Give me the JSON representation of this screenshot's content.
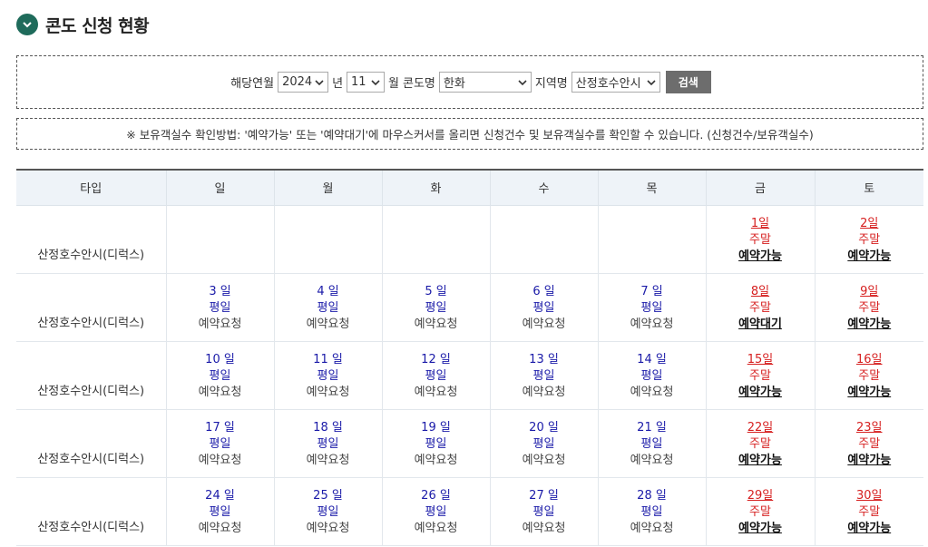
{
  "page_title": "콘도 신청 현황",
  "search": {
    "year_label": "해당연월",
    "year_value": "2024",
    "year_unit": "년",
    "month_value": "11",
    "month_unit": "월",
    "condo_label": "콘도명",
    "condo_value": "한화",
    "region_label": "지역명",
    "region_value": "산정호수안시",
    "search_button": "검색"
  },
  "notice": "※ 보유객실수 확인방법: '예약가능' 또는 '예약대기'에 마우스커서를 올리면 신청건수 및 보유객실수를 확인할 수 있습니다. (신청건수/보유객실수)",
  "columns": [
    "타입",
    "일",
    "월",
    "화",
    "수",
    "목",
    "금",
    "토"
  ],
  "rows": [
    {
      "type": "산정호수안시(디럭스)",
      "cells": [
        null,
        null,
        null,
        null,
        null,
        {
          "day": "1일",
          "kind": "주말",
          "status": "예약가능",
          "weekend": true
        },
        {
          "day": "2일",
          "kind": "주말",
          "status": "예약가능",
          "weekend": true
        }
      ]
    },
    {
      "type": "산정호수안시(디럭스)",
      "cells": [
        {
          "day": "3 일",
          "kind": "평일",
          "status": "예약요청",
          "weekend": false
        },
        {
          "day": "4 일",
          "kind": "평일",
          "status": "예약요청",
          "weekend": false
        },
        {
          "day": "5 일",
          "kind": "평일",
          "status": "예약요청",
          "weekend": false
        },
        {
          "day": "6 일",
          "kind": "평일",
          "status": "예약요청",
          "weekend": false
        },
        {
          "day": "7 일",
          "kind": "평일",
          "status": "예약요청",
          "weekend": false
        },
        {
          "day": "8일",
          "kind": "주말",
          "status": "예약대기",
          "weekend": true
        },
        {
          "day": "9일",
          "kind": "주말",
          "status": "예약가능",
          "weekend": true
        }
      ]
    },
    {
      "type": "산정호수안시(디럭스)",
      "cells": [
        {
          "day": "10 일",
          "kind": "평일",
          "status": "예약요청",
          "weekend": false
        },
        {
          "day": "11 일",
          "kind": "평일",
          "status": "예약요청",
          "weekend": false
        },
        {
          "day": "12 일",
          "kind": "평일",
          "status": "예약요청",
          "weekend": false
        },
        {
          "day": "13 일",
          "kind": "평일",
          "status": "예약요청",
          "weekend": false
        },
        {
          "day": "14 일",
          "kind": "평일",
          "status": "예약요청",
          "weekend": false
        },
        {
          "day": "15일",
          "kind": "주말",
          "status": "예약가능",
          "weekend": true
        },
        {
          "day": "16일",
          "kind": "주말",
          "status": "예약가능",
          "weekend": true
        }
      ]
    },
    {
      "type": "산정호수안시(디럭스)",
      "cells": [
        {
          "day": "17 일",
          "kind": "평일",
          "status": "예약요청",
          "weekend": false
        },
        {
          "day": "18 일",
          "kind": "평일",
          "status": "예약요청",
          "weekend": false
        },
        {
          "day": "19 일",
          "kind": "평일",
          "status": "예약요청",
          "weekend": false
        },
        {
          "day": "20 일",
          "kind": "평일",
          "status": "예약요청",
          "weekend": false
        },
        {
          "day": "21 일",
          "kind": "평일",
          "status": "예약요청",
          "weekend": false
        },
        {
          "day": "22일",
          "kind": "주말",
          "status": "예약가능",
          "weekend": true
        },
        {
          "day": "23일",
          "kind": "주말",
          "status": "예약가능",
          "weekend": true
        }
      ]
    },
    {
      "type": "산정호수안시(디럭스)",
      "cells": [
        {
          "day": "24 일",
          "kind": "평일",
          "status": "예약요청",
          "weekend": false
        },
        {
          "day": "25 일",
          "kind": "평일",
          "status": "예약요청",
          "weekend": false
        },
        {
          "day": "26 일",
          "kind": "평일",
          "status": "예약요청",
          "weekend": false
        },
        {
          "day": "27 일",
          "kind": "평일",
          "status": "예약요청",
          "weekend": false
        },
        {
          "day": "28 일",
          "kind": "평일",
          "status": "예약요청",
          "weekend": false
        },
        {
          "day": "29일",
          "kind": "주말",
          "status": "예약가능",
          "weekend": true
        },
        {
          "day": "30일",
          "kind": "주말",
          "status": "예약가능",
          "weekend": true
        }
      ]
    }
  ],
  "colors": {
    "header_icon": "#1f6b5b",
    "weekday": "#1a1aa8",
    "weekend": "#d61f1f",
    "search_button": "#6d6d6d",
    "table_header_bg": "#eef3f8"
  }
}
